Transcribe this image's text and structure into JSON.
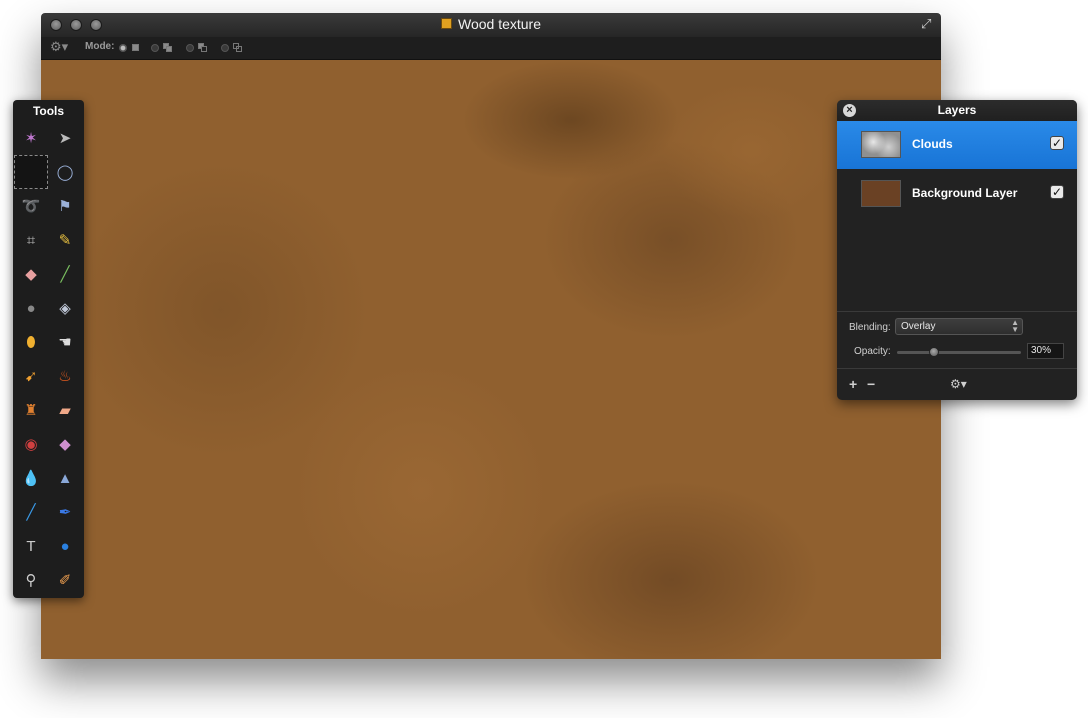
{
  "window": {
    "title": "Wood texture",
    "toolbar": {
      "gear_icon": "gear-icon",
      "mode_label": "Mode:",
      "mode_options": [
        "new-selection",
        "add-selection",
        "subtract-selection",
        "intersect-selection"
      ],
      "mode_selected": 0
    },
    "canvas_color": "#90602f"
  },
  "tools": {
    "title": "Tools",
    "items": [
      {
        "name": "magic-wand",
        "glyph": "✶",
        "color": "#c078d0"
      },
      {
        "name": "move",
        "glyph": "➤",
        "color": "#bbbbbb"
      },
      {
        "name": "rect-select",
        "glyph": "",
        "color": "#bbbbbb",
        "selected": true
      },
      {
        "name": "ellipse-select",
        "glyph": "◯",
        "color": "#9ab0d8"
      },
      {
        "name": "lasso",
        "glyph": "➰",
        "color": "#9ab0d8"
      },
      {
        "name": "polygon-lasso",
        "glyph": "⚑",
        "color": "#9ab0d8"
      },
      {
        "name": "crop",
        "glyph": "⌗",
        "color": "#bbbbbb"
      },
      {
        "name": "pencil",
        "glyph": "✎",
        "color": "#e8c040"
      },
      {
        "name": "eraser",
        "glyph": "◆",
        "color": "#e8a0a0"
      },
      {
        "name": "brush",
        "glyph": "╱",
        "color": "#7ac060"
      },
      {
        "name": "spray",
        "glyph": "●",
        "color": "#888888"
      },
      {
        "name": "fill",
        "glyph": "◈",
        "color": "#c0c8d8"
      },
      {
        "name": "sponge",
        "glyph": "⬮",
        "color": "#f0b030"
      },
      {
        "name": "smudge",
        "glyph": "☚",
        "color": "#dddddd"
      },
      {
        "name": "burn",
        "glyph": "➹",
        "color": "#f0a030"
      },
      {
        "name": "dodge",
        "glyph": "♨",
        "color": "#f06020"
      },
      {
        "name": "clone-stamp",
        "glyph": "♜",
        "color": "#e08030"
      },
      {
        "name": "heal",
        "glyph": "▰",
        "color": "#f0a888"
      },
      {
        "name": "red-eye",
        "glyph": "◉",
        "color": "#d04040"
      },
      {
        "name": "eraser-2",
        "glyph": "◆",
        "color": "#d090d0"
      },
      {
        "name": "blur",
        "glyph": "💧",
        "color": "#6aa0e0"
      },
      {
        "name": "sharpen",
        "glyph": "▲",
        "color": "#8aa8d8"
      },
      {
        "name": "pen",
        "glyph": "╱",
        "color": "#3a9ae8"
      },
      {
        "name": "freeform-pen",
        "glyph": "✒",
        "color": "#3a7ae8"
      },
      {
        "name": "text",
        "glyph": "T",
        "color": "#cccccc"
      },
      {
        "name": "shape",
        "glyph": "●",
        "color": "#2a80e0"
      },
      {
        "name": "zoom",
        "glyph": "⚲",
        "color": "#cccccc"
      },
      {
        "name": "eyedropper",
        "glyph": "✐",
        "color": "#f0a050"
      }
    ]
  },
  "layers": {
    "title": "Layers",
    "rows": [
      {
        "name": "Clouds",
        "visible": true,
        "selected": true,
        "thumb": "clouds"
      },
      {
        "name": "Background Layer",
        "visible": true,
        "selected": false,
        "thumb": "solid",
        "thumb_color": "#6a4124"
      }
    ],
    "blending_label": "Blending:",
    "blending_value": "Overlay",
    "opacity_label": "Opacity:",
    "opacity_value": "30%",
    "opacity_fraction": 0.3,
    "footer": {
      "add": "+",
      "remove": "−",
      "gear_icon": "gear-icon"
    }
  }
}
